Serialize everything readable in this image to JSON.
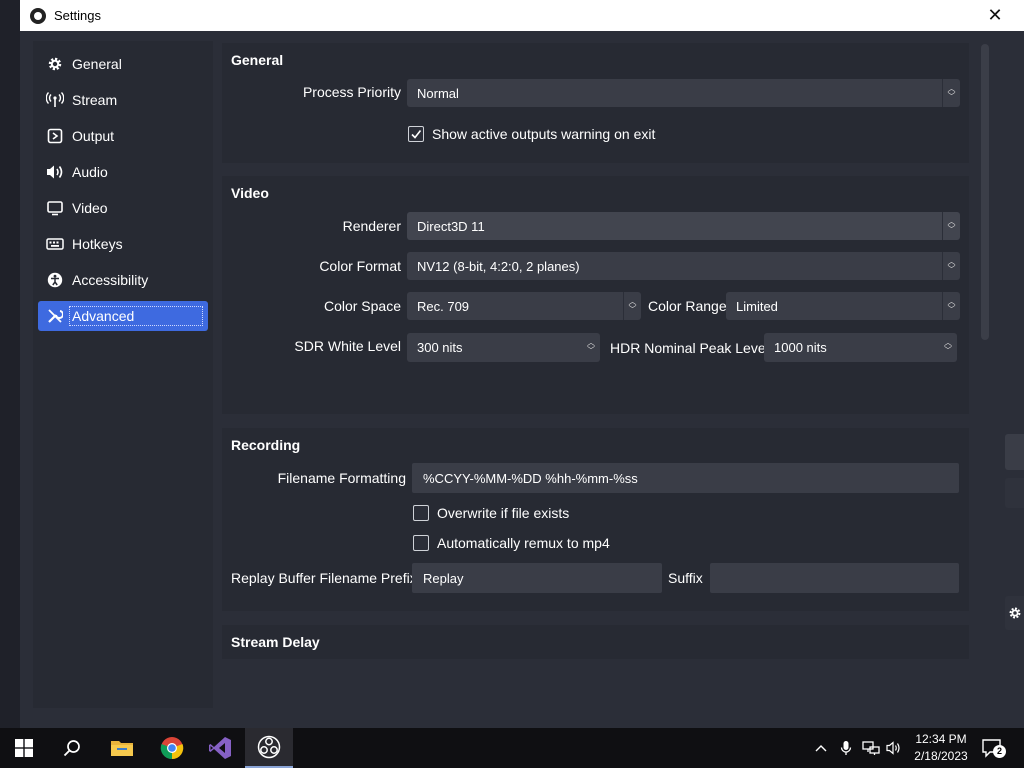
{
  "window": {
    "title": "Settings",
    "close_glyph": "✕"
  },
  "sidebar": {
    "items": [
      {
        "label": "General",
        "icon": "gear-icon"
      },
      {
        "label": "Stream",
        "icon": "antenna-icon"
      },
      {
        "label": "Output",
        "icon": "output-icon"
      },
      {
        "label": "Audio",
        "icon": "speaker-icon"
      },
      {
        "label": "Video",
        "icon": "monitor-icon"
      },
      {
        "label": "Hotkeys",
        "icon": "keyboard-icon"
      },
      {
        "label": "Accessibility",
        "icon": "accessibility-icon"
      },
      {
        "label": "Advanced",
        "icon": "wrench-icon",
        "active": true
      }
    ]
  },
  "general": {
    "title": "General",
    "process_priority_label": "Process Priority",
    "process_priority_value": "Normal",
    "show_outputs_warning_label": "Show active outputs warning on exit",
    "show_outputs_warning_checked": true
  },
  "video": {
    "title": "Video",
    "renderer_label": "Renderer",
    "renderer_value": "Direct3D 11",
    "color_format_label": "Color Format",
    "color_format_value": "NV12 (8-bit, 4:2:0, 2 planes)",
    "color_space_label": "Color Space",
    "color_space_value": "Rec. 709",
    "color_range_label": "Color Range",
    "color_range_value": "Limited",
    "sdr_white_label": "SDR White Level",
    "sdr_white_value": "300 nits",
    "hdr_peak_label": "HDR Nominal Peak Level",
    "hdr_peak_value": "1000 nits"
  },
  "recording": {
    "title": "Recording",
    "filename_formatting_label": "Filename Formatting",
    "filename_formatting_value": "%CCYY-%MM-%DD %hh-%mm-%ss",
    "overwrite_label": "Overwrite if file exists",
    "overwrite_checked": false,
    "remux_label": "Automatically remux to mp4",
    "remux_checked": false,
    "replay_prefix_label": "Replay Buffer Filename Prefix",
    "replay_prefix_value": "Replay",
    "suffix_label": "Suffix",
    "suffix_value": ""
  },
  "stream_delay": {
    "title": "Stream Delay"
  },
  "taskbar": {
    "apps": [
      "windows-start-icon",
      "search-icon",
      "file-explorer-icon",
      "chrome-icon",
      "visual-studio-icon",
      "obs-icon"
    ],
    "time": "12:34 PM",
    "date": "2/18/2023",
    "notification_count": "2"
  },
  "colors": {
    "accent": "#3e6ae0",
    "panel": "#272a33",
    "field": "#3a3d47",
    "background": "#2b2e38"
  }
}
